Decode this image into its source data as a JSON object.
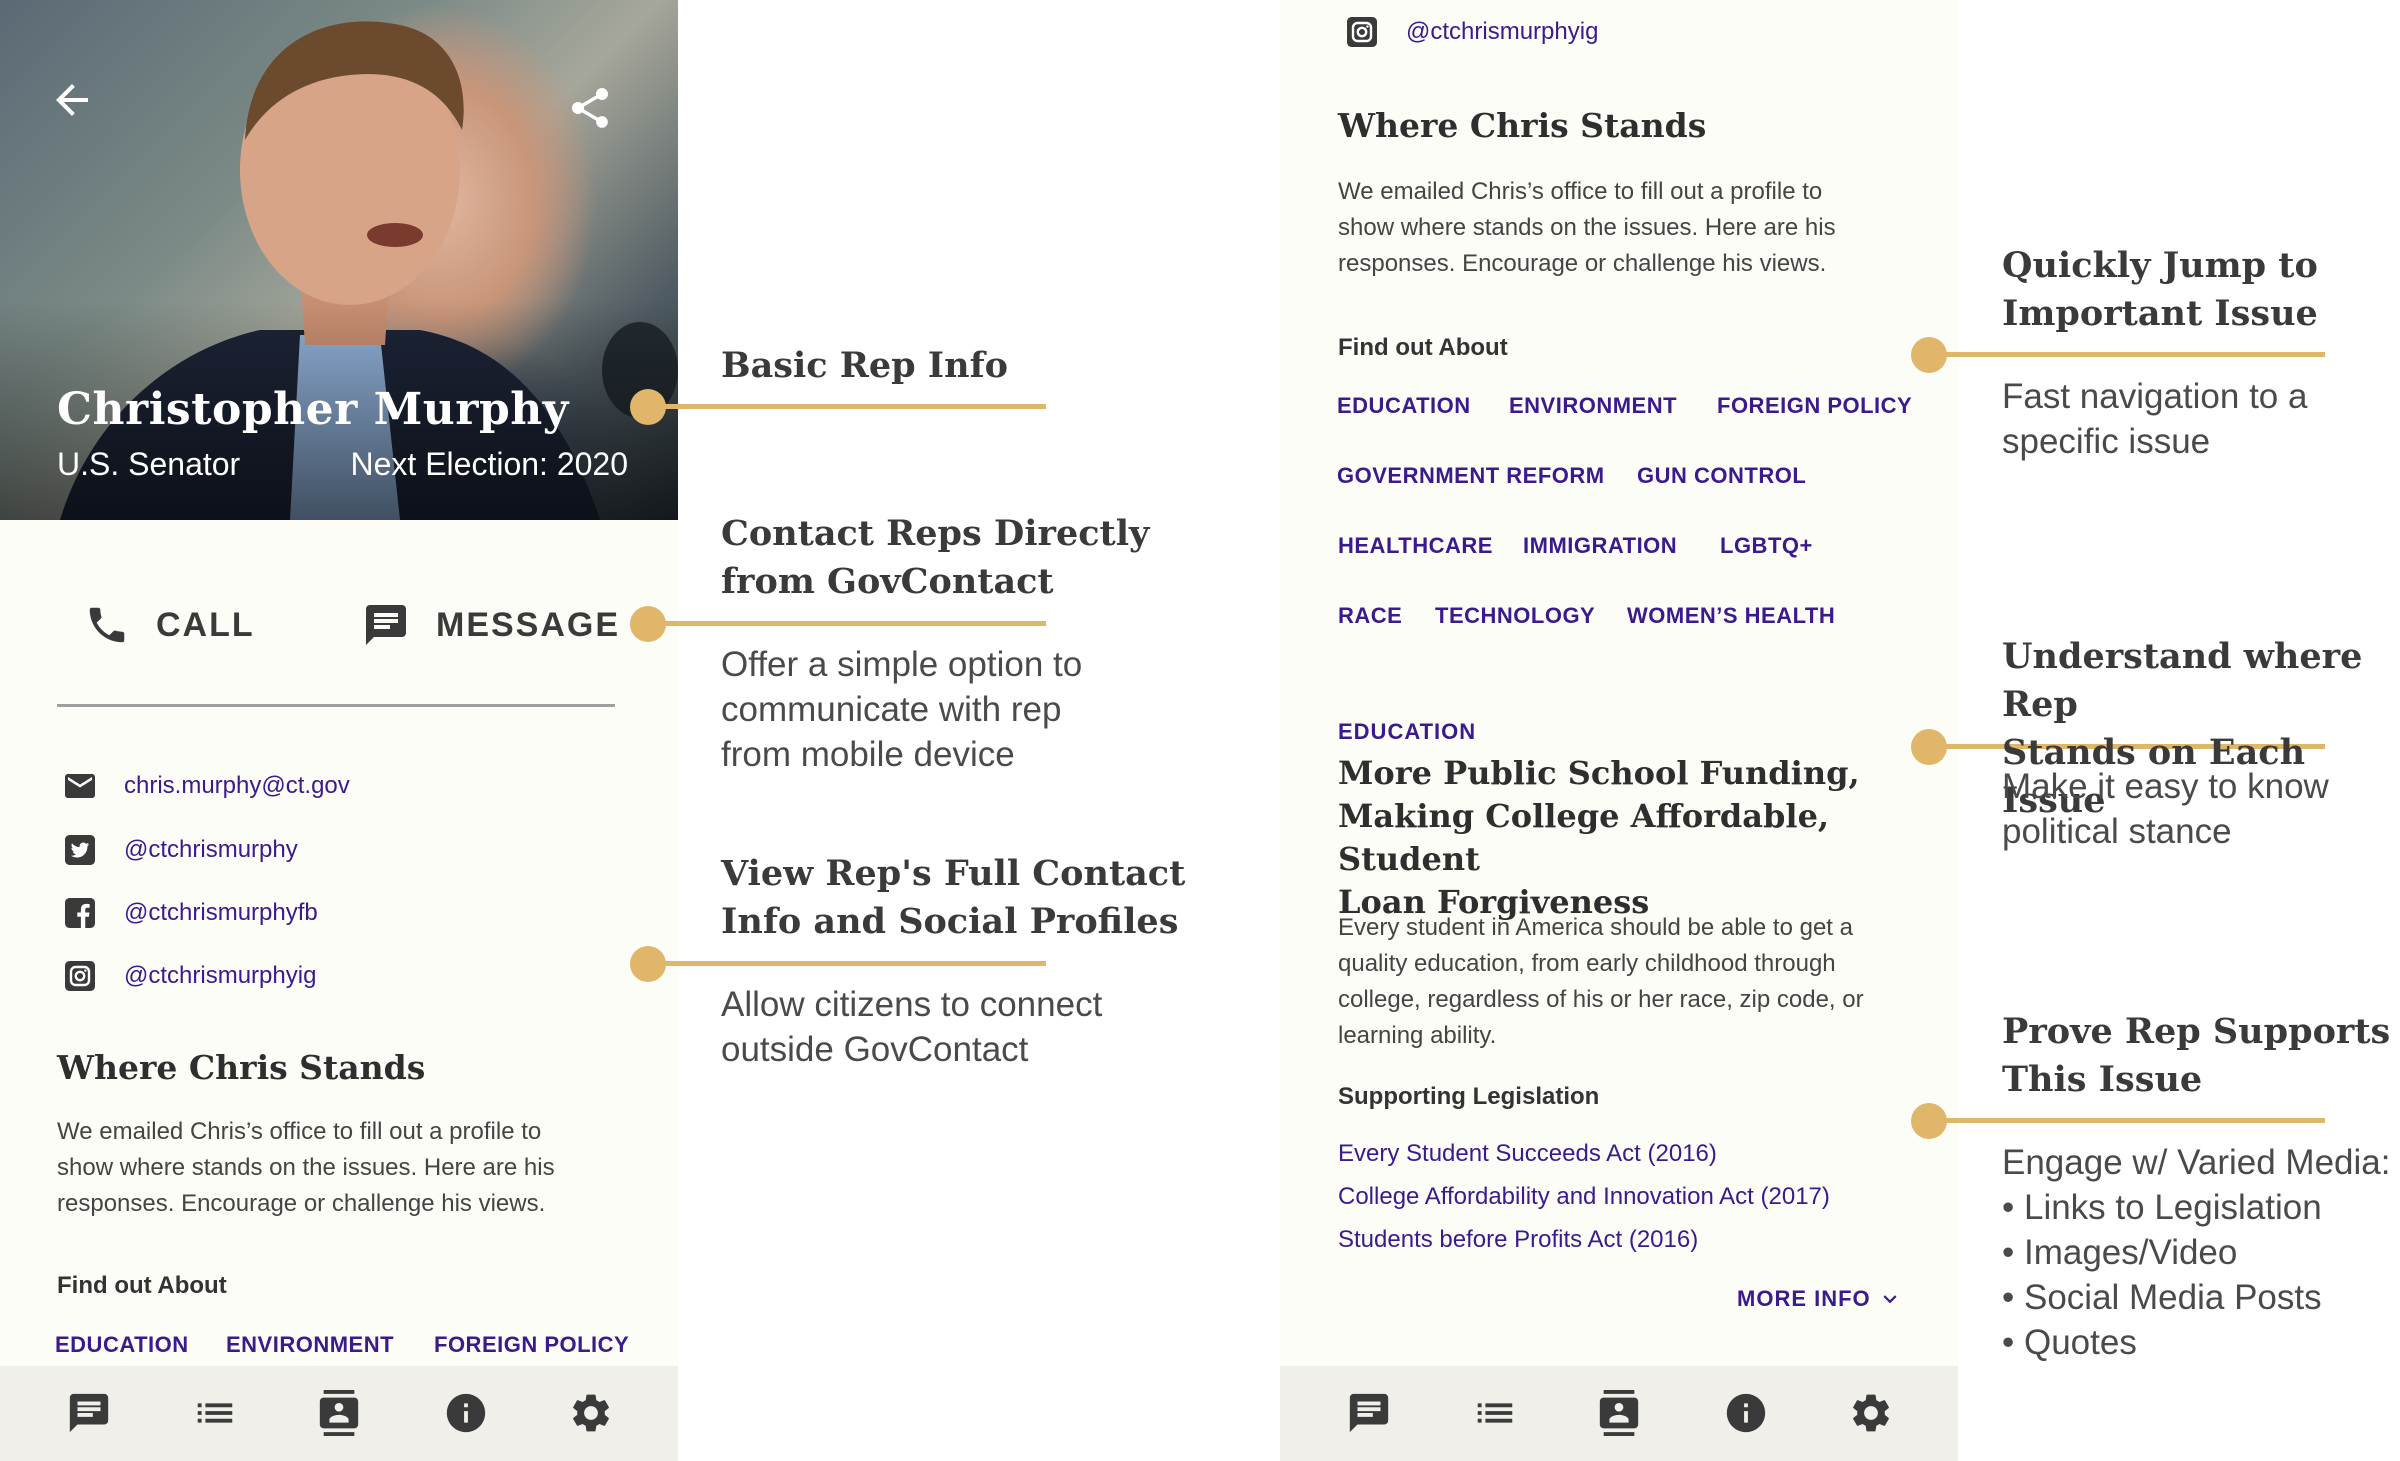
{
  "colors": {
    "accent": "#dfb66a",
    "link": "#3a1a8c",
    "screen_bg": "#fdfdf8",
    "nav_bg": "#f0efe9"
  },
  "rep": {
    "name": "Christopher Murphy",
    "title": "U.S. Senator",
    "election": "Next Election: 2020"
  },
  "actions": {
    "call": "CALL",
    "message": "MESSAGE"
  },
  "contacts": {
    "email": "chris.murphy@ct.gov",
    "twitter": "@ctchrismurphy",
    "facebook": "@ctchrismurphyfb",
    "instagram": "@ctchrismurphyig"
  },
  "stands": {
    "heading": "Where Chris Stands",
    "intro_lines": [
      "We emailed Chris’s office to fill out a profile to",
      "show where stands on the issues. Here are his",
      "responses. Encourage or challenge his views."
    ],
    "find_out": "Find out About",
    "tags": [
      "EDUCATION",
      "ENVIRONMENT",
      "FOREIGN POLICY",
      "GOVERNMENT REFORM",
      "GUN CONTROL",
      "HEALTHCARE",
      "IMMIGRATION",
      "LGBTQ+",
      "RACE",
      "TECHNOLOGY",
      "WOMEN’S HEALTH"
    ]
  },
  "issue": {
    "category": "EDUCATION",
    "title_lines": [
      "More Public School Funding,",
      "Making College Affordable, Student",
      "Loan Forgiveness"
    ],
    "body_lines": [
      "Every student in America should be able to get a",
      "quality education, from early childhood through",
      "college, regardless of his or her race, zip code, or",
      "learning ability."
    ],
    "legislation_heading": "Supporting Legislation",
    "legislation": [
      "Every Student Succeeds Act (2016)",
      "College Affordability and Innovation Act (2017)",
      "Students before Profits Act (2016)"
    ],
    "more_info": "MORE INFO"
  },
  "nav": {
    "items": [
      {
        "icon": "message-icon"
      },
      {
        "icon": "list-icon"
      },
      {
        "icon": "contact-card-icon"
      },
      {
        "icon": "info-icon"
      },
      {
        "icon": "gear-icon"
      }
    ]
  },
  "annotations": {
    "basic_info": {
      "title": "Basic Rep Info"
    },
    "contact": {
      "title_lines": [
        "Contact Reps Directly",
        "from GovContact"
      ],
      "text_lines": [
        "Offer a simple option to",
        "communicate with rep",
        "from mobile device"
      ]
    },
    "full_contact": {
      "title_lines": [
        "View Rep's Full Contact",
        "Info and Social Profiles"
      ],
      "text_lines": [
        "Allow citizens to connect",
        "outside GovContact"
      ]
    },
    "jump": {
      "title_lines": [
        "Quickly Jump to",
        "Important Issue"
      ],
      "text_lines": [
        "Fast navigation to a",
        "specific issue"
      ]
    },
    "stance": {
      "title_lines": [
        "Understand where Rep",
        "Stands on Each Issue"
      ],
      "text_lines": [
        "Make it easy to know",
        "political stance"
      ]
    },
    "support": {
      "title_lines": [
        "Prove Rep Supports",
        "This Issue"
      ],
      "text_lines": [
        "Engage w/ Varied Media:",
        "• Links to Legislation",
        "• Images/Video",
        "• Social Media Posts",
        "• Quotes"
      ]
    }
  }
}
